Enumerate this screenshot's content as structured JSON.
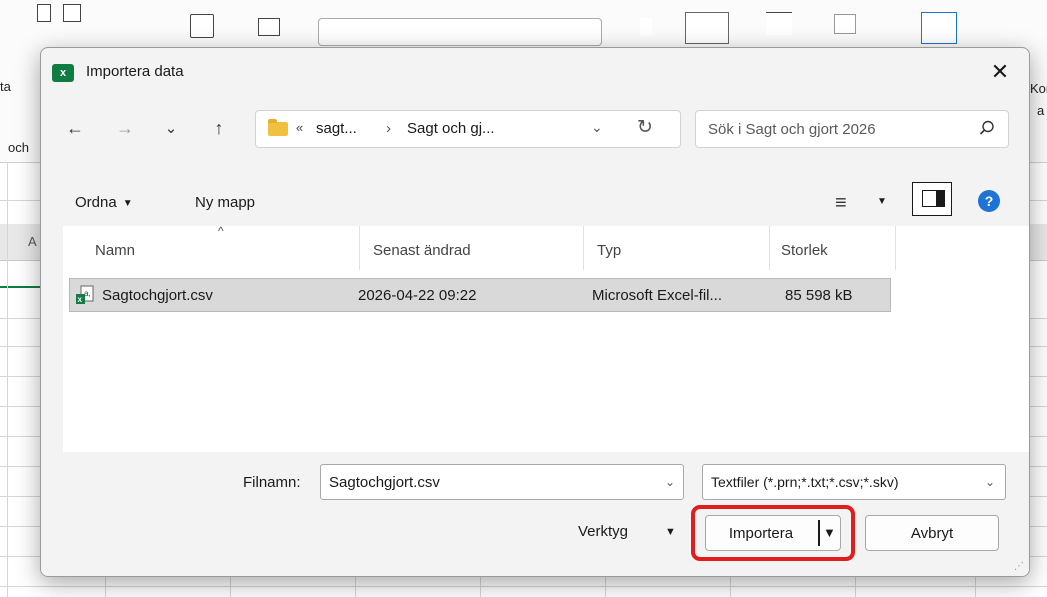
{
  "background": {
    "ribbon_fragments": [
      "ta",
      "och",
      "Kor",
      "a"
    ],
    "column_letter": "A"
  },
  "dialog": {
    "app_icon_letter": "x",
    "title": "Importera data",
    "close_label": "✕",
    "nav": {
      "back": "←",
      "forward": "→",
      "recent": "⌄",
      "up": "↑"
    },
    "address": {
      "overflow": "«",
      "crumbs": [
        "sagt...",
        "Sagt och gj..."
      ],
      "separator": "›",
      "dropdown": "⌄",
      "refresh": "↻"
    },
    "search": {
      "placeholder": "Sök i Sagt och gjort 2026"
    },
    "toolbar": {
      "organize": "Ordna",
      "new_folder": "Ny mapp",
      "view_icon": "≡",
      "help_label": "?"
    },
    "columns": [
      "Namn",
      "Senast ändrad",
      "Typ",
      "Storlek"
    ],
    "files": [
      {
        "name": "Sagtochgjort.csv",
        "modified": "2026-04-22 09:22",
        "type": "Microsoft Excel-fil...",
        "size": "85 598 kB"
      }
    ],
    "filename_label": "Filnamn:",
    "filename_value": "Sagtochgjort.csv",
    "filter_value": "Textfiler (*.prn;*.txt;*.csv;*.skv)",
    "tools_label": "Verktyg",
    "import_label": "Importera",
    "cancel_label": "Avbryt"
  },
  "colors": {
    "excel_green": "#107c41",
    "highlight_red": "#e01e1e",
    "help_blue": "#1e73d6",
    "folder_yellow": "#f0c040"
  }
}
